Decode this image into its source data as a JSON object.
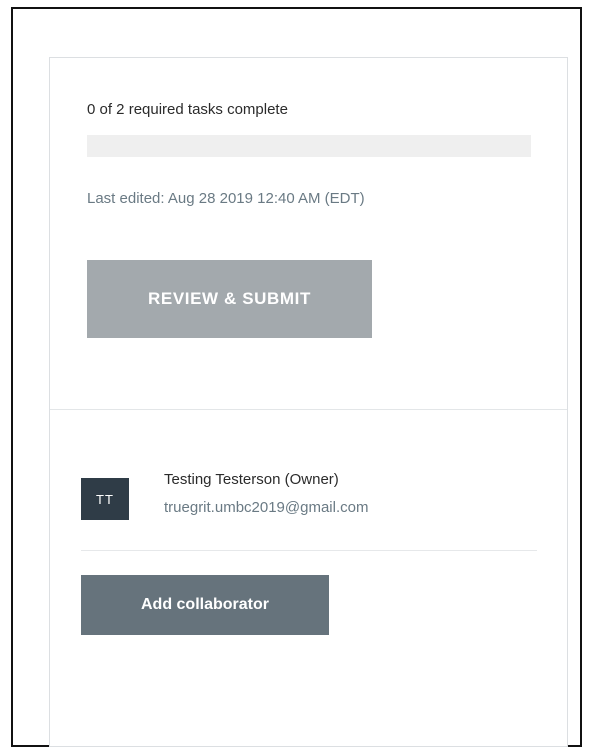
{
  "progress": {
    "status_text": "0 of 2 required tasks complete",
    "completed": 0,
    "required": 2,
    "fraction": 0,
    "last_edited": "Last edited: Aug 28 2019 12:40 AM (EDT)",
    "review_label": "REVIEW & SUBMIT"
  },
  "collaborators": {
    "items": [
      {
        "initials": "TT",
        "name": "Testing Testerson (Owner)",
        "email": "truegrit.umbc2019@gmail.com"
      }
    ],
    "add_label": "Add collaborator"
  },
  "colors": {
    "primary_button_disabled": "#a3a9ad",
    "secondary_button": "#66737c",
    "avatar": "#2f3c47",
    "progress_track": "#efefef",
    "muted_text": "#6a7a84"
  }
}
